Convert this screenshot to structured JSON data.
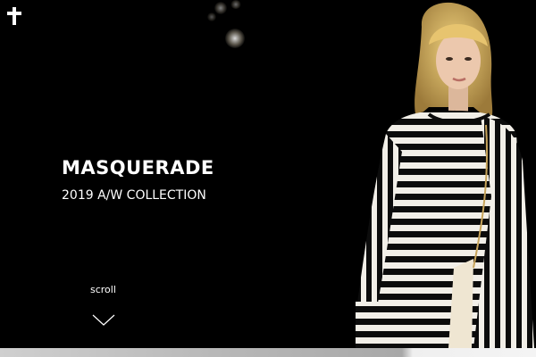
{
  "hero": {
    "title": "MASQUERADE",
    "subtitle": "2019 A/W COLLECTION",
    "scroll_label": "scroll"
  },
  "icons": {
    "logo": "cross-icon",
    "scroll_indicator": "chevron-down-icon"
  },
  "colors": {
    "background": "#000000",
    "text": "#ffffff",
    "hair": "#d9b56a",
    "skin": "#e8c4a8"
  }
}
